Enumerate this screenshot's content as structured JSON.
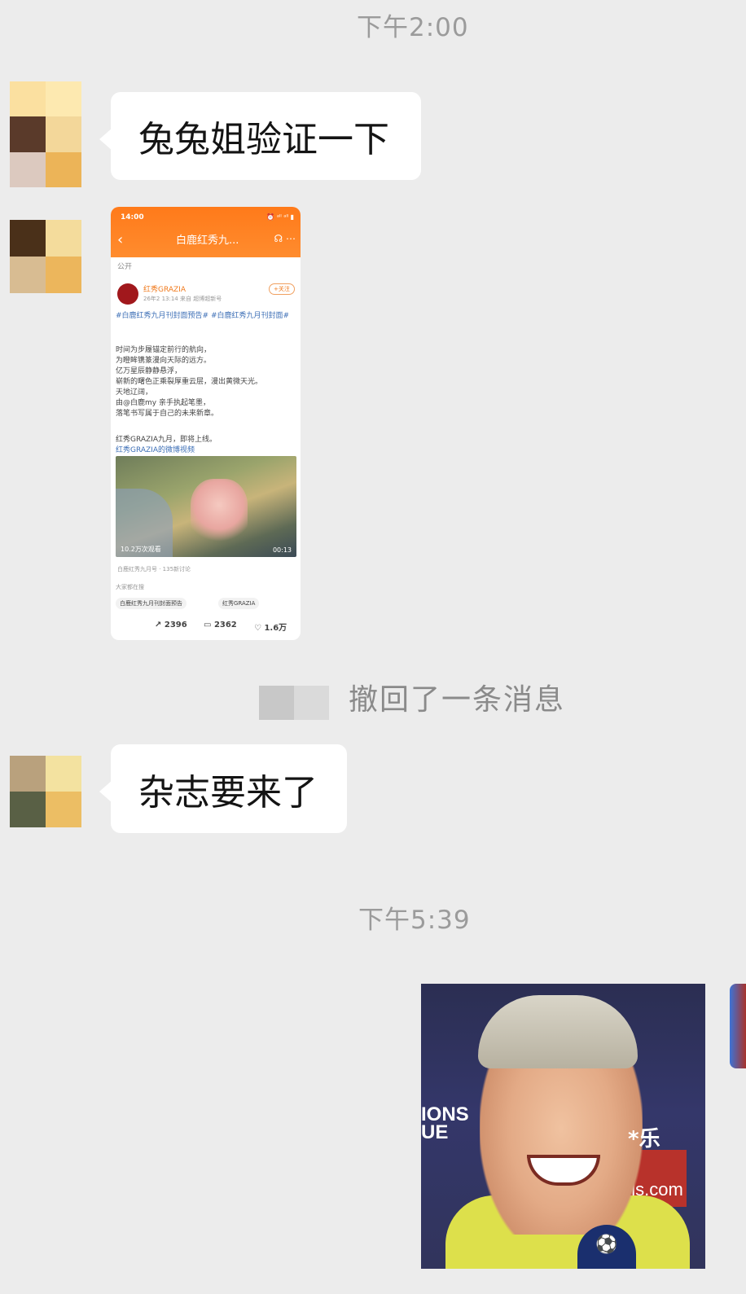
{
  "chat": {
    "timestamps": [
      "下午2:00",
      "下午5:39"
    ],
    "messages": {
      "m1_text": "兔兔姐验证一下",
      "m3_text": "杂志要来了"
    },
    "recall_notice": "撤回了一条消息",
    "colors": {
      "background": "#ececec",
      "bubble": "#ffffff",
      "timestamp": "#9b9b9b"
    }
  },
  "weibo_card": {
    "status_time": "14:00",
    "status_icons": "⏰ ᵃˡˡ ᵃˡˡ ▮",
    "back_icon": "‹",
    "title": "白鹿红秀九...",
    "header_icons": "☊ ⋯",
    "visibility": "公开",
    "account_name": "红秀GRAZIA",
    "follow_label": "+关注",
    "post_meta": "26年2 13:14 来自 超博超新号",
    "hashtags": "#白鹿红秀九月刊封面预告# #白鹿红秀九月刊封面#",
    "body_lines": [
      "时间为步履锚定前行的航向，",
      "为瞪眸镌篆漫向天际的远方。",
      "亿万星辰静静悬浮，",
      "崭新的曙色正乘裂厚重云层，漫出黄微天光。",
      "天地辽阔，",
      "由@白鹿my 亲手执起笔墨，",
      "落笔书写属于自己的未来新章。",
      "",
      "红秀GRAZIA九月，即将上线。"
    ],
    "video_link": "红秀GRAZIA的微博视频",
    "video_views": "10.2万次观看",
    "video_duration": "00:13",
    "topic_line": "白鹿红秀九月号 · 135新讨论",
    "search_label": "大家都在搜",
    "search_tags": [
      "白鹿红秀九月刊封面预告",
      "红秀GRAZIA"
    ],
    "stats": {
      "reposts": "2396",
      "comments": "2362",
      "likes": "1.6万"
    }
  },
  "meme": {
    "caption": "*乐",
    "sponsor_left": "IONS\nUE",
    "sponsor_right": "els.com"
  }
}
